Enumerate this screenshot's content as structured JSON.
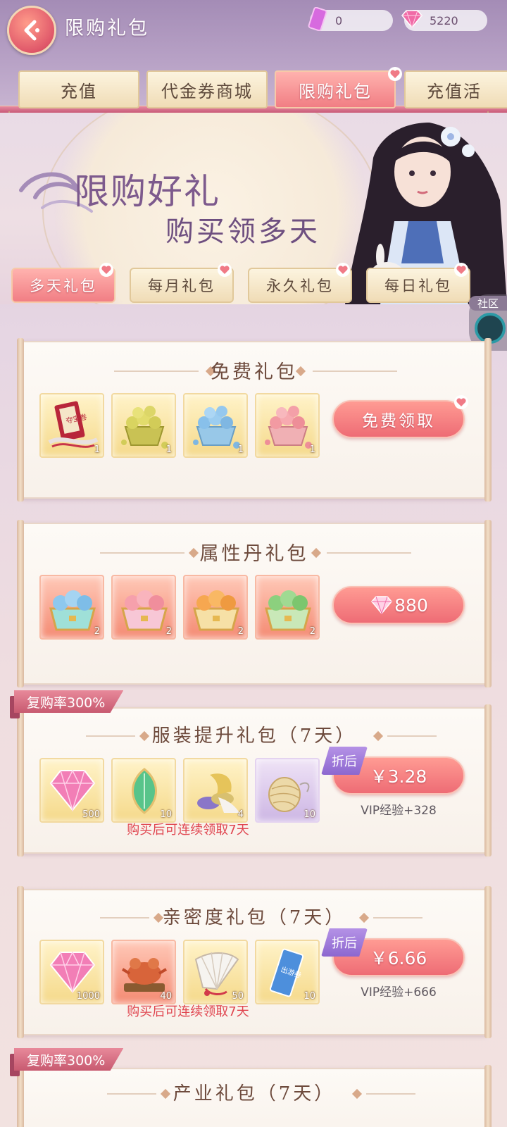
{
  "header": {
    "title": "限购礼包",
    "currencies": [
      {
        "name": "vouchers",
        "icon": "voucher-icon",
        "value": "0"
      },
      {
        "name": "diamonds",
        "icon": "diamond-icon",
        "value": "5220"
      }
    ]
  },
  "main_tabs": [
    {
      "label": "充值",
      "active": false
    },
    {
      "label": "代金券商城",
      "active": false
    },
    {
      "label": "限购礼包",
      "active": true
    },
    {
      "label": "充值活"
    }
  ],
  "banner": {
    "title": "限购好礼",
    "subtitle": "购买领多天"
  },
  "sub_tabs": [
    {
      "label": "多天礼包",
      "active": true
    },
    {
      "label": "每月礼包",
      "active": false
    },
    {
      "label": "永久礼包",
      "active": false
    },
    {
      "label": "每日礼包",
      "active": false
    }
  ],
  "community": {
    "label": "社区"
  },
  "packs": [
    {
      "title": "免费礼包",
      "items": [
        {
          "icon": "seal-scroll-icon",
          "qty": "1"
        },
        {
          "icon": "yellow-pill-basket-icon",
          "qty": "1"
        },
        {
          "icon": "blue-pill-basket-icon",
          "qty": "1"
        },
        {
          "icon": "pink-pill-basket-icon",
          "qty": "1"
        }
      ],
      "button": "免费领取"
    },
    {
      "title": "属性丹礼包",
      "items": [
        {
          "icon": "blue-peach-box-icon",
          "qty": "2"
        },
        {
          "icon": "pink-peach-box-icon",
          "qty": "2"
        },
        {
          "icon": "orange-peach-box-icon",
          "qty": "2"
        },
        {
          "icon": "green-peach-box-icon",
          "qty": "2"
        }
      ],
      "button": "880"
    },
    {
      "ribbon": "复购率300%",
      "title": "服装提升礼包（7天）",
      "items": [
        {
          "icon": "diamond-icon",
          "qty": "500"
        },
        {
          "icon": "jade-leaf-icon",
          "qty": "10"
        },
        {
          "icon": "fabric-rolls-icon",
          "qty": "4"
        },
        {
          "icon": "silk-ball-icon",
          "qty": "10"
        }
      ],
      "discount": "折后",
      "button": "￥3.28",
      "vip": "VIP经验+328",
      "note": "购买后可连续领取7天"
    },
    {
      "title": "亲密度礼包（7天）",
      "items": [
        {
          "icon": "diamond-icon",
          "qty": "1000"
        },
        {
          "icon": "bronze-ornament-icon",
          "qty": "40"
        },
        {
          "icon": "folding-fan-icon",
          "qty": "50"
        },
        {
          "icon": "outing-ticket-icon",
          "qty": "10"
        }
      ],
      "discount": "折后",
      "button": "￥6.66",
      "vip": "VIP经验+666",
      "note": "购买后可连续领取7天"
    },
    {
      "ribbon": "复购率300%",
      "title": "产业礼包（7天）"
    }
  ],
  "ticket_text": "出游券",
  "scroll_text": "夺宝卷",
  "colors": {
    "accent": "#ee6c75",
    "note_red": "#e0454f",
    "discount_purple": "#8c67cf"
  }
}
